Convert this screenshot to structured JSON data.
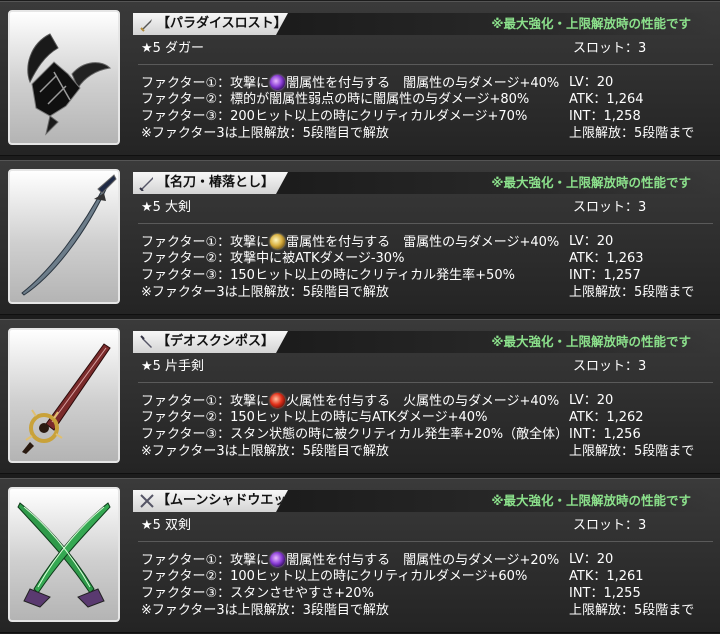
{
  "weapons": [
    {
      "title": "【パラダイスロスト】",
      "title_icon": "dagger-icon",
      "max_note": "※最大強化・上限解放時の性能です",
      "rarity_type": "★5 ダガー",
      "slot": "スロット：3",
      "factor1_pre": "ファクター①：攻撃に",
      "factor1_element_icon": "dark-element-icon",
      "factor1_post": "闇属性を付与する　闇属性の与ダメージ+40%",
      "factor2": "ファクター②：標的が闇属性弱点の時に闇属性の与ダメージ+80%",
      "factor3": "ファクター③：200ヒット以上の時にクリティカルダメージ+70%",
      "note": "※ファクター3は上限解放：5段階目で解放",
      "lv": "LV：20",
      "atk": "ATK：1,264",
      "int": "INT：1,258",
      "limit": "上限解放：5段階まで"
    },
    {
      "title": "【名刀・椿落とし】",
      "title_icon": "greatsword-icon",
      "max_note": "※最大強化・上限解放時の性能です",
      "rarity_type": "★5 大剣",
      "slot": "スロット：3",
      "factor1_pre": "ファクター①：攻撃に",
      "factor1_element_icon": "thunder-element-icon",
      "factor1_post": "雷属性を付与する　雷属性の与ダメージ+40%",
      "factor2": "ファクター②：攻撃中に被ATKダメージ-30%",
      "factor3": "ファクター③：150ヒット以上の時にクリティカル発生率+50%",
      "note": "※ファクター3は上限解放：5段階目で解放",
      "lv": "LV：20",
      "atk": "ATK：1,263",
      "int": "INT：1,257",
      "limit": "上限解放：5段階まで"
    },
    {
      "title": "【デオスクシポス】",
      "title_icon": "one-handed-sword-icon",
      "max_note": "※最大強化・上限解放時の性能です",
      "rarity_type": "★5 片手剣",
      "slot": "スロット：3",
      "factor1_pre": "ファクター①：攻撃に",
      "factor1_element_icon": "fire-element-icon",
      "factor1_post": "火属性を付与する　火属性の与ダメージ+40%",
      "factor2": "ファクター②：150ヒット以上の時に与ATKダメージ+40%",
      "factor3": "ファクター③：スタン状態の時に被クリティカル発生率+20%（敵全体）",
      "note": "※ファクター3は上限解放：5段階目で解放",
      "lv": "LV：20",
      "atk": "ATK：1,262",
      "int": "INT：1,256",
      "limit": "上限解放：5段階まで"
    },
    {
      "title": "【ムーンシャドウエッジ】",
      "title_icon": "dual-blades-icon",
      "max_note": "※最大強化・上限解放時の性能です",
      "rarity_type": "★5 双剣",
      "slot": "スロット：3",
      "factor1_pre": "ファクター①：攻撃に",
      "factor1_element_icon": "dark-element-icon",
      "factor1_post": "闇属性を付与する　闇属性の与ダメージ+20%",
      "factor2": "ファクター②：100ヒット以上の時にクリティカルダメージ+60%",
      "factor3": "ファクター③：スタンさせやすさ+20%",
      "note": "※ファクター3は上限解放：3段階目で解放",
      "lv": "LV：20",
      "atk": "ATK：1,261",
      "int": "INT：1,255",
      "limit": "上限解放：5段階まで"
    }
  ],
  "colors": {
    "note_green": "#8be08b",
    "panel_dark": "#2b2b2b",
    "text_white": "#ffffff"
  }
}
